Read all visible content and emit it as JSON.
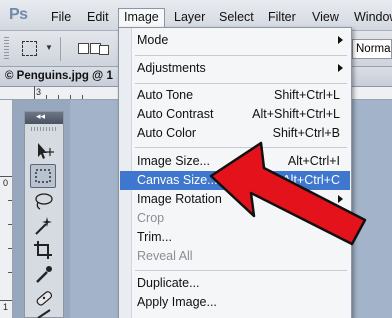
{
  "menubar": {
    "logo": "Ps",
    "items": [
      "File",
      "Edit",
      "Image",
      "Layer",
      "Select",
      "Filter",
      "View",
      "Window"
    ]
  },
  "options_bar": {
    "style_value": "Normal"
  },
  "document": {
    "tab_title": "© Penguins.jpg @ 1"
  },
  "rulers": {
    "h_numbers": [
      "3"
    ],
    "v_numbers": [
      "0",
      "1"
    ]
  },
  "image_menu": {
    "items": [
      {
        "label": "Mode",
        "shortcut": "",
        "submenu": true,
        "highlighted": false,
        "disabled": false
      },
      {
        "label": "Adjustments",
        "shortcut": "",
        "submenu": true,
        "highlighted": false,
        "disabled": false
      },
      {
        "label": "Auto Tone",
        "shortcut": "Shift+Ctrl+L",
        "submenu": false,
        "highlighted": false,
        "disabled": false
      },
      {
        "label": "Auto Contrast",
        "shortcut": "Alt+Shift+Ctrl+L",
        "submenu": false,
        "highlighted": false,
        "disabled": false
      },
      {
        "label": "Auto Color",
        "shortcut": "Shift+Ctrl+B",
        "submenu": false,
        "highlighted": false,
        "disabled": false
      },
      {
        "label": "Image Size...",
        "shortcut": "Alt+Ctrl+I",
        "submenu": false,
        "highlighted": false,
        "disabled": false
      },
      {
        "label": "Canvas Size...",
        "shortcut": "Alt+Ctrl+C",
        "submenu": false,
        "highlighted": true,
        "disabled": false
      },
      {
        "label": "Image Rotation",
        "shortcut": "",
        "submenu": true,
        "highlighted": false,
        "disabled": false
      },
      {
        "label": "Crop",
        "shortcut": "",
        "submenu": false,
        "highlighted": false,
        "disabled": true
      },
      {
        "label": "Trim...",
        "shortcut": "",
        "submenu": false,
        "highlighted": false,
        "disabled": false
      },
      {
        "label": "Reveal All",
        "shortcut": "",
        "submenu": false,
        "highlighted": false,
        "disabled": true
      },
      {
        "label": "Duplicate...",
        "shortcut": "",
        "submenu": false,
        "highlighted": false,
        "disabled": false
      },
      {
        "label": "Apply Image...",
        "shortcut": "",
        "submenu": false,
        "highlighted": false,
        "disabled": false
      }
    ]
  },
  "colors": {
    "highlight": "#3f77cf",
    "arrow_fill": "#e3121b",
    "arrow_stroke": "#111111"
  },
  "tool_icons": [
    "move-icon",
    "rectangular-marquee-icon",
    "lasso-icon",
    "magic-wand-icon",
    "crop-icon",
    "eyedropper-icon",
    "healing-brush-icon",
    "brush-icon"
  ]
}
